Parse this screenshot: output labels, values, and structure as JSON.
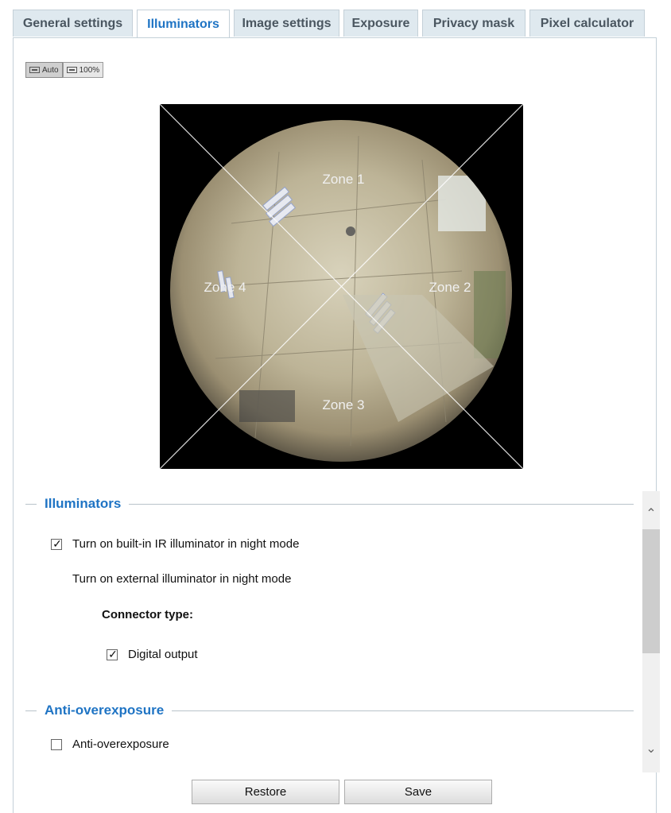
{
  "tabs": [
    {
      "label": "General settings"
    },
    {
      "label": "Illuminators"
    },
    {
      "label": "Image settings"
    },
    {
      "label": "Exposure"
    },
    {
      "label": "Privacy mask"
    },
    {
      "label": "Pixel calculator"
    }
  ],
  "active_tab": "Illuminators",
  "zoom": {
    "auto_label": "Auto",
    "full_label": "100%",
    "selected": "Auto"
  },
  "preview": {
    "zones": [
      "Zone 1",
      "Zone 2",
      "Zone 3",
      "Zone 4"
    ]
  },
  "illuminators": {
    "legend": "Illuminators",
    "builtin_ir": {
      "label": "Turn on built-in IR illuminator in night mode",
      "checked": true
    },
    "external_label": "Turn on external illuminator in night mode",
    "connector_type_label": "Connector type:",
    "digital_output": {
      "label": "Digital output",
      "checked": true
    }
  },
  "anti_overexposure": {
    "legend": "Anti-overexposure",
    "checkbox": {
      "label": "Anti-overexposure",
      "checked": false
    }
  },
  "icons": {
    "scroll_up": "chevron-up-icon",
    "scroll_down": "chevron-down-icon",
    "check": "checkmark-icon"
  },
  "buttons": {
    "restore": "Restore",
    "save": "Save"
  },
  "colors": {
    "accent": "#1f74c4",
    "tab_bg": "#dfe9ef"
  }
}
